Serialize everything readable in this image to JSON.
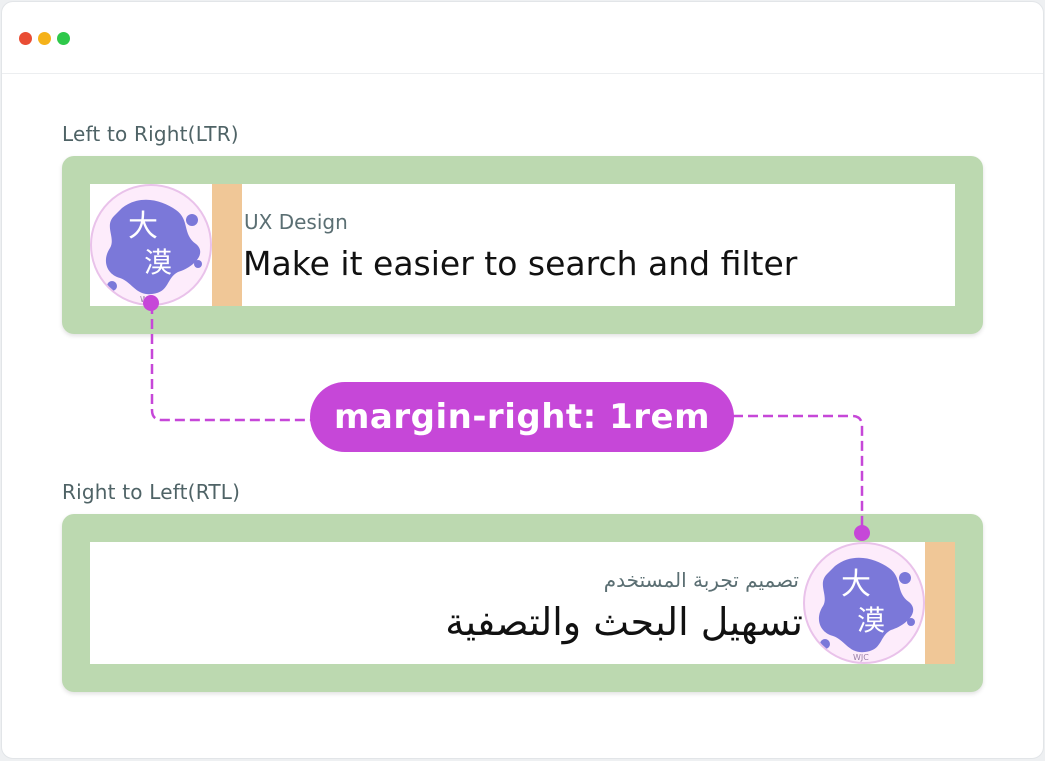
{
  "colors": {
    "card_bg": "#bcd9b0",
    "stripe": "#f0c797",
    "accent": "#c647d8",
    "avatar_blob": "#7b78d9",
    "window_dots": [
      "#e94d34",
      "#f5b21a",
      "#2ec84a"
    ]
  },
  "ltr": {
    "section_label": "Left to Right(LTR)",
    "eyebrow": "UX Design",
    "headline": "Make it easier to search and filter"
  },
  "rtl": {
    "section_label": "Right to Left(RTL)",
    "eyebrow": "تصميم تجربة المستخدم",
    "headline": "تسهيل البحث والتصفية"
  },
  "annotation": {
    "label": "margin-right: 1rem"
  },
  "avatar": {
    "glyph_top": "大",
    "glyph_bottom": "漠",
    "caption": "WJC"
  }
}
